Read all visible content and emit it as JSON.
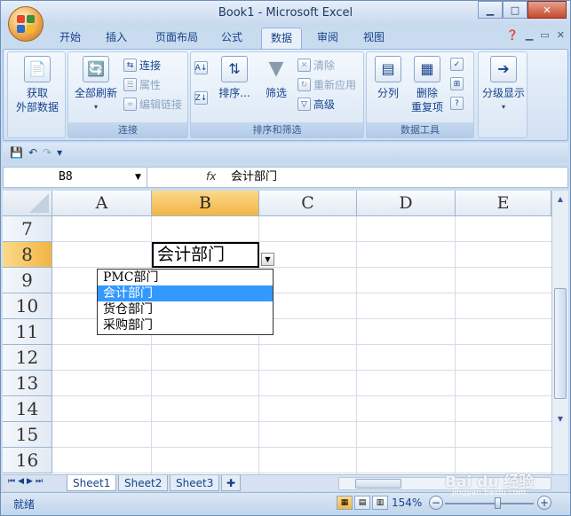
{
  "window": {
    "title": "Book1 - Microsoft Excel",
    "minimize_icon": "minimize-icon",
    "maximize_icon": "maximize-icon",
    "close_icon": "close-icon"
  },
  "tabs": [
    "开始",
    "插入",
    "页面布局",
    "公式",
    "数据",
    "审阅",
    "视图"
  ],
  "active_tab": "数据",
  "ribbon": {
    "groups": {
      "external": {
        "label": "获取\n外部数据",
        "line1": "获取",
        "line2": "外部数据"
      },
      "connections": {
        "label": "连接",
        "refresh_all": "全部刷新",
        "connect": "连接",
        "properties": "属性",
        "edit_links": "编辑链接"
      },
      "sort_filter": {
        "label": "排序和筛选",
        "sort": "排序...",
        "filter": "筛选",
        "clear": "清除",
        "reapply": "重新应用",
        "advanced": "高级"
      },
      "data_tools": {
        "label": "数据工具",
        "text_to_columns": "分列",
        "remove_duplicates_line1": "删除",
        "remove_duplicates_line2": "重复项"
      },
      "outline": {
        "label": "分级显示"
      }
    }
  },
  "formula_bar": {
    "name_box": "B8",
    "fx": "fx",
    "value": "会计部门"
  },
  "grid": {
    "columns": [
      "A",
      "B",
      "C",
      "D",
      "E"
    ],
    "rows": [
      "7",
      "8",
      "9",
      "10",
      "11",
      "12",
      "13",
      "14",
      "15",
      "16"
    ],
    "selected_column": "B",
    "selected_row": "8",
    "active_cell_value": "会计部门"
  },
  "dropdown": {
    "options": [
      "PMC部门",
      "会计部门",
      "货仓部门",
      "采购部门"
    ],
    "selected_index": 1
  },
  "sheets": [
    "Sheet1",
    "Sheet2",
    "Sheet3"
  ],
  "active_sheet": "Sheet1",
  "status": {
    "ready": "就绪",
    "zoom": "154%"
  },
  "watermark": {
    "text": "Bai du 经验",
    "sub": "jingyan.baidu.com"
  },
  "colors": {
    "accent_selected": "#f2b544",
    "dropdown_highlight": "#3399ff",
    "ribbon_text": "#15428b"
  }
}
